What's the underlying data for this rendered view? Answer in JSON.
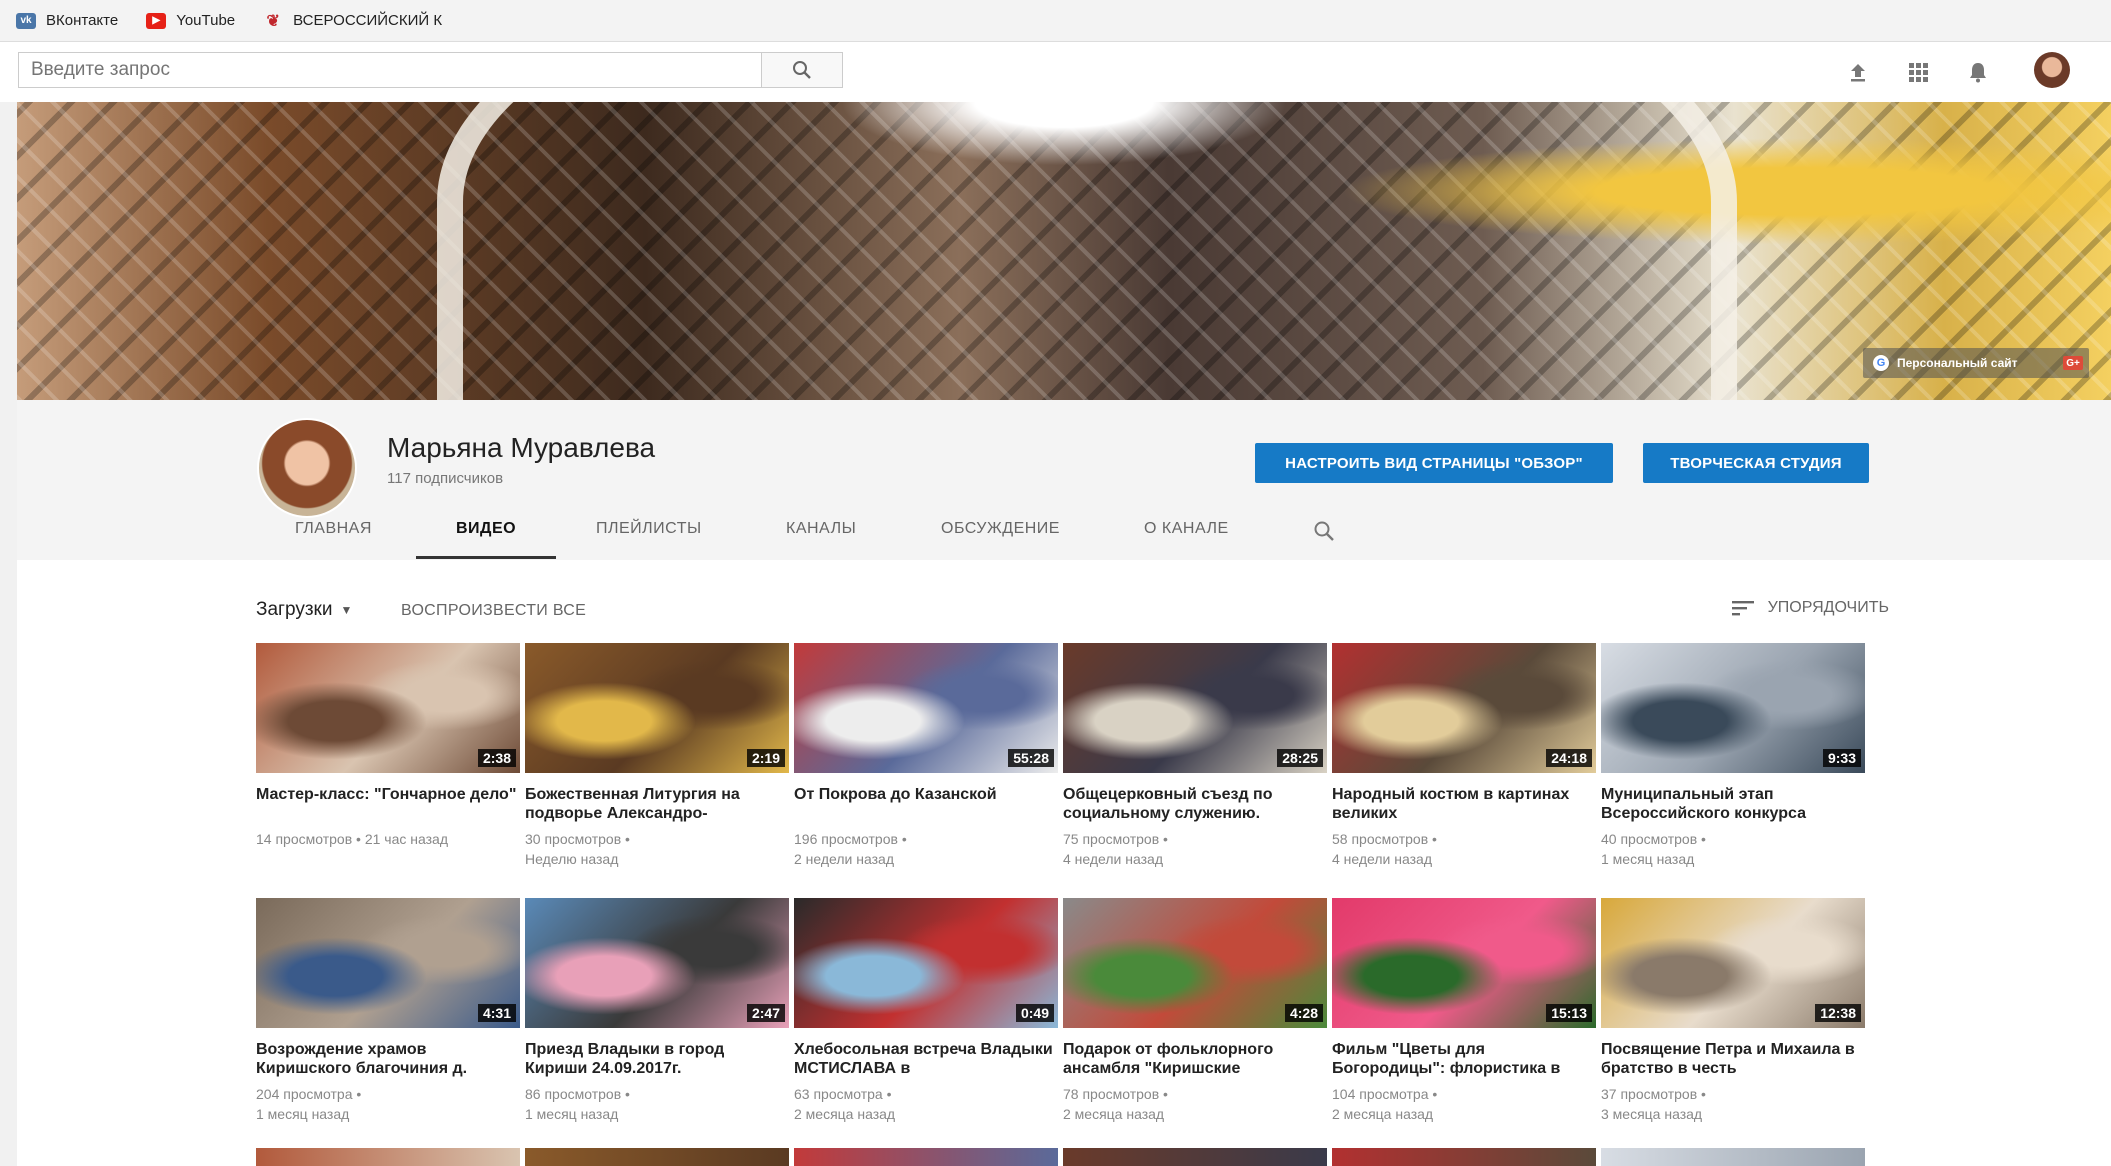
{
  "bookmarks": [
    {
      "label": "ВКонтакте",
      "icon": "vk-icon",
      "color": "#4a76a8"
    },
    {
      "label": "YouTube",
      "icon": "youtube-icon",
      "color": "#e62117"
    },
    {
      "label": "ВСЕРОССИЙСКИЙ К",
      "icon": "flame-icon",
      "color": "#c1272d"
    }
  ],
  "search": {
    "placeholder": "Введите запрос"
  },
  "header_icons": [
    "upload-icon",
    "apps-icon",
    "notifications-icon",
    "avatar"
  ],
  "banner": {
    "link_label": "Персональный сайт",
    "gplus_label": "G+"
  },
  "channel": {
    "name": "Марьяна Муравлева",
    "subscribers": "117 подписчиков",
    "customize_button": "НАСТРОИТЬ ВИД СТРАНИЦЫ \"ОБЗОР\"",
    "studio_button": "ТВОРЧЕСКАЯ СТУДИЯ"
  },
  "tabs": [
    "ГЛАВНАЯ",
    "ВИДЕО",
    "ПЛЕЙЛИСТЫ",
    "КАНАЛЫ",
    "ОБСУЖДЕНИЕ",
    "О КАНАЛЕ"
  ],
  "active_tab": "ВИДЕО",
  "filter": {
    "uploads": "Загрузки",
    "play_all": "ВОСПРОИЗВЕСТИ ВСЕ",
    "sort": "УПОРЯДОЧИТЬ"
  },
  "videos": [
    {
      "title": "Мастер-класс: \"Гончарное дело\"",
      "duration": "2:38",
      "views": "14 просмотров • 21 час назад",
      "age": "",
      "colors": [
        "#b25a3c",
        "#6d4a36",
        "#d9c4b0"
      ]
    },
    {
      "title": "Божественная Литургия на подворье Александро-",
      "duration": "2:19",
      "views": "30 просмотров •",
      "age": "Неделю назад",
      "colors": [
        "#8a5a2a",
        "#e2b84a",
        "#5a3a22"
      ]
    },
    {
      "title": "От Покрова до Казанской",
      "duration": "55:28",
      "views": "196 просмотров •",
      "age": "2 недели назад",
      "colors": [
        "#c23a3a",
        "#ededed",
        "#5a6a9a"
      ]
    },
    {
      "title": "Общецерковный съезд по социальному служению.",
      "duration": "28:25",
      "views": "75 просмотров •",
      "age": "4 недели назад",
      "colors": [
        "#6a3a2a",
        "#d9d2c4",
        "#3a3a4a"
      ]
    },
    {
      "title": "Народный костюм в картинах великих",
      "duration": "24:18",
      "views": "58 просмотров •",
      "age": "4 недели назад",
      "colors": [
        "#b23030",
        "#e2cc9a",
        "#5a4a3a"
      ]
    },
    {
      "title": "Муниципальный этап Всероссийского конкурса",
      "duration": "9:33",
      "views": "40 просмотров •",
      "age": "1 месяц назад",
      "colors": [
        "#d8dde4",
        "#3a4a5a",
        "#9aa4b0"
      ]
    },
    {
      "title": "Возрождение храмов Киришского благочиния д.",
      "duration": "4:31",
      "views": "204 просмотра •",
      "age": "1 месяц назад",
      "colors": [
        "#7a6a5a",
        "#3a5a8a",
        "#b0a090"
      ]
    },
    {
      "title": "Приезд Владыки в город Кириши 24.09.2017г.",
      "duration": "2:47",
      "views": "86 просмотров •",
      "age": "1 месяц назад",
      "colors": [
        "#5a8ab8",
        "#e8a0b8",
        "#3a3a3a"
      ]
    },
    {
      "title": "Хлебосольная встреча Владыки МСТИСЛАВА в",
      "duration": "0:49",
      "views": "63 просмотра •",
      "age": "2 месяца назад",
      "colors": [
        "#2a2a2a",
        "#8ab8d8",
        "#c23030"
      ]
    },
    {
      "title": "Подарок от фольклорного ансамбля \"Киришские",
      "duration": "4:28",
      "views": "78 просмотров •",
      "age": "2 месяца назад",
      "colors": [
        "#8a8a8a",
        "#4a8a3a",
        "#c24a3a"
      ]
    },
    {
      "title": "Фильм \"Цветы для Богородицы\": флористика в",
      "duration": "15:13",
      "views": "104 просмотра •",
      "age": "2 месяца назад",
      "colors": [
        "#e23a6a",
        "#2a6a2a",
        "#f05a8a"
      ]
    },
    {
      "title": "Посвящение Петра и Михаила в братство в честь",
      "duration": "12:38",
      "views": "37 просмотров •",
      "age": "3 месяца назад",
      "colors": [
        "#d8a83a",
        "#8a7a6a",
        "#e8dccc"
      ]
    }
  ]
}
